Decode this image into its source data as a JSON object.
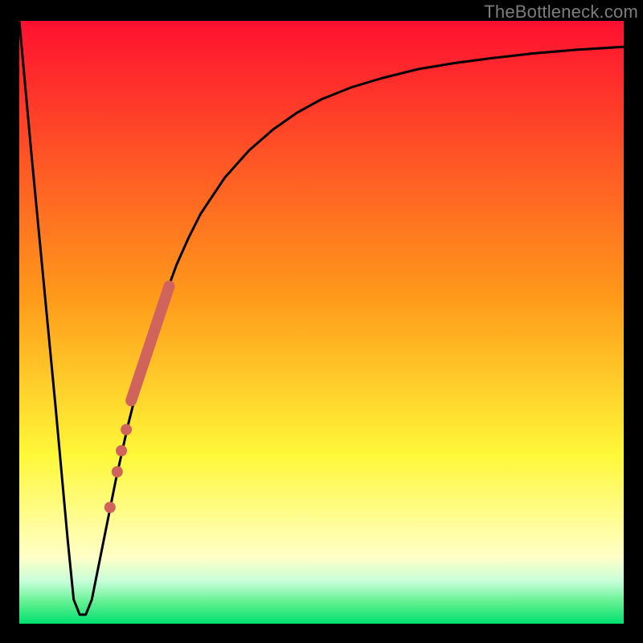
{
  "watermark": "TheBottleneck.com",
  "colors": {
    "frame": "#000000",
    "curve": "#000000",
    "overlay_stroke": "#d0645c",
    "overlay_dot_fill": "#d0645c",
    "grad_top": "#ff1030",
    "grad_mid1": "#ff9a1a",
    "grad_mid2": "#fff838",
    "grad_pale": "#ffffc8",
    "grad_green_light": "#c6ffd8",
    "grad_green_mid": "#60f090",
    "grad_green": "#00e070"
  },
  "chart_data": {
    "type": "line",
    "title": "",
    "xlabel": "",
    "ylabel": "",
    "xlim": [
      0,
      100
    ],
    "ylim": [
      0,
      100
    ],
    "series": [
      {
        "name": "bottleneck-curve",
        "x": [
          0,
          2,
          4,
          6,
          8,
          9,
          10,
          11,
          12,
          14,
          16,
          18,
          20,
          22,
          24,
          26,
          28,
          30,
          34,
          38,
          42,
          46,
          50,
          55,
          60,
          66,
          72,
          78,
          85,
          92,
          100
        ],
        "y": [
          100,
          78,
          57,
          36,
          14,
          4,
          1.5,
          1.5,
          4,
          14,
          24,
          33,
          41,
          48,
          54,
          59.5,
          64,
          68,
          74,
          78.5,
          82,
          84.8,
          87,
          89,
          90.5,
          92,
          93,
          93.8,
          94.6,
          95.2,
          95.7
        ]
      }
    ],
    "overlay_segment": {
      "name": "highlight-band",
      "x": [
        18.5,
        24.8
      ],
      "y": [
        37,
        56
      ]
    },
    "overlay_dots": {
      "name": "highlight-dots",
      "points": [
        {
          "x": 17.7,
          "y": 32.2
        },
        {
          "x": 16.9,
          "y": 28.7
        },
        {
          "x": 16.2,
          "y": 25.2
        },
        {
          "x": 15.0,
          "y": 19.3
        }
      ]
    }
  }
}
